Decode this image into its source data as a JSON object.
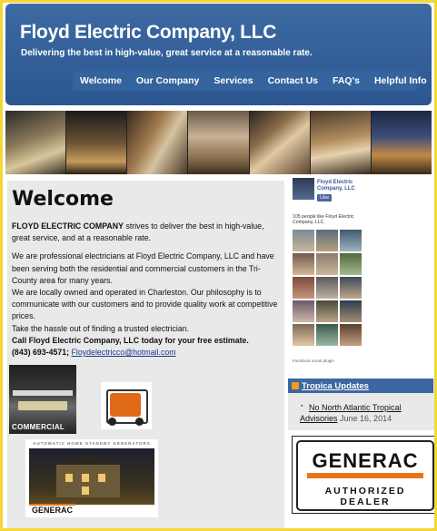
{
  "header": {
    "title": "Floyd Electric Company, LLC",
    "tagline": "Delivering the best in high-value, great service at a reasonable rate.",
    "bg_color": "#2f5c98"
  },
  "nav": {
    "items": [
      {
        "label": "Welcome"
      },
      {
        "label": "Our Company"
      },
      {
        "label": "Services"
      },
      {
        "label": "Contact Us"
      },
      {
        "label": "FAQ's"
      },
      {
        "label": "Helpful Info"
      }
    ]
  },
  "main": {
    "heading": "Welcome",
    "intro_bold": "FLOYD ELECTRIC COMPANY",
    "intro_rest": " strives to deliver the best in high-value, great service, and at a reasonable rate.",
    "para1": "We are professional electricians at Floyd Electric Company, LLC and have been serving both the residential and commercial customers in the Tri-County area for many years.",
    "para2": "We are locally owned and operated in Charleston. Our  philosophy is to communicate with our customers and to provide quality work at competitive prices.",
    "para3": "Take the hassle out of finding a trusted electrician.",
    "call_to_action": "Call Floyd Electric Company, LLC today for your free estimate.",
    "phone": "(843) 693-4571;",
    "email": "Floydelectricco@hotmail.com",
    "commercial_label": "COMMERCIAL",
    "generac_small_label": "GENERAC",
    "house_caption": "AUTOMATIC HOME STANDBY GENERATORS"
  },
  "facebook": {
    "page_name": "Floyd Electric Company, LLC",
    "like_label": "Like",
    "likes_text": "105 people like Floyd Electric Company, LLC.",
    "plugin_text": "Facebook social plugin"
  },
  "tropica": {
    "title": "Tropica Updates",
    "item_link": "No North Atlantic Tropical Advisories",
    "item_date": "June 16, 2014"
  },
  "generac_ad": {
    "brand": "GENERAC",
    "subtitle": "AUTHORIZED DEALER"
  }
}
